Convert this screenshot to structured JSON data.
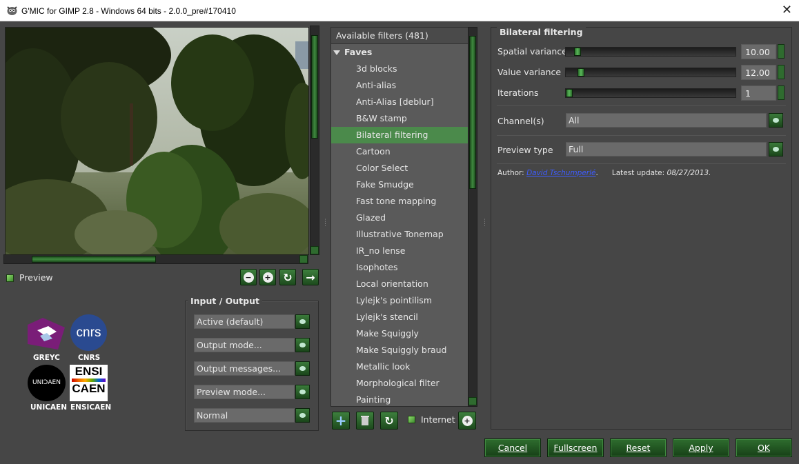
{
  "window": {
    "title": "G'MIC for GIMP 2.8 - Windows 64 bits - 2.0.0_pre#170410",
    "close_glyph": "✕"
  },
  "preview": {
    "checkbox_label": "Preview",
    "checked": true
  },
  "zoom_buttons": {
    "zoom_out": "−",
    "zoom_in": "+",
    "refresh": "↻",
    "apply": "→"
  },
  "io": {
    "title": "Input / Output",
    "combos": [
      "Active (default)",
      "Output mode...",
      "Output messages...",
      "Preview mode...",
      "Normal"
    ]
  },
  "logos": {
    "greyc": "GREYC",
    "cnrs": "CNRS",
    "cnrs_mark": "cnrs",
    "unicaen": "UNICAEN",
    "unicaen_mark": "UNIↃAEN",
    "ensicaen": "ENSICAEN",
    "ensicaen_mark_1": "ENSI",
    "ensicaen_mark_2": "CAEN"
  },
  "filters": {
    "header": "Available filters (481)",
    "category": "Faves",
    "items": [
      "3d blocks",
      "Anti-alias",
      "Anti-Alias [deblur]",
      "B&W stamp",
      "Bilateral filtering",
      "Cartoon",
      "Color Select",
      "Fake Smudge",
      "Fast tone mapping",
      "Glazed",
      "Illustrative Tonemap",
      "IR_no lense",
      "Isophotes",
      "Local orientation",
      "Lylejk's pointilism",
      "Lylejk's stencil",
      "Make Squiggly",
      "Make Squiggly braud",
      "Metallic look",
      "Morphological filter",
      "Painting"
    ],
    "selected_index": 4,
    "internet_label": "Internet"
  },
  "params": {
    "title": "Bilateral filtering",
    "spatial_label": "Spatial variance",
    "spatial_value": "10.00",
    "spatial_pos": 0.05,
    "value_label": "Value variance",
    "value_value": "12.00",
    "value_pos": 0.07,
    "iter_label": "Iterations",
    "iter_value": "1",
    "iter_pos": 0.0,
    "channels_label": "Channel(s)",
    "channels_value": "All",
    "preview_type_label": "Preview type",
    "preview_type_value": "Full",
    "author_label": "Author:",
    "author_name": "David Tschumperlé",
    "author_dot": ".",
    "update_label": "Latest update:",
    "update_value": "08/27/2013."
  },
  "buttons": {
    "cancel": "Cancel",
    "fullscreen": "Fullscreen",
    "reset": "Reset",
    "apply": "Apply",
    "ok": "OK"
  }
}
